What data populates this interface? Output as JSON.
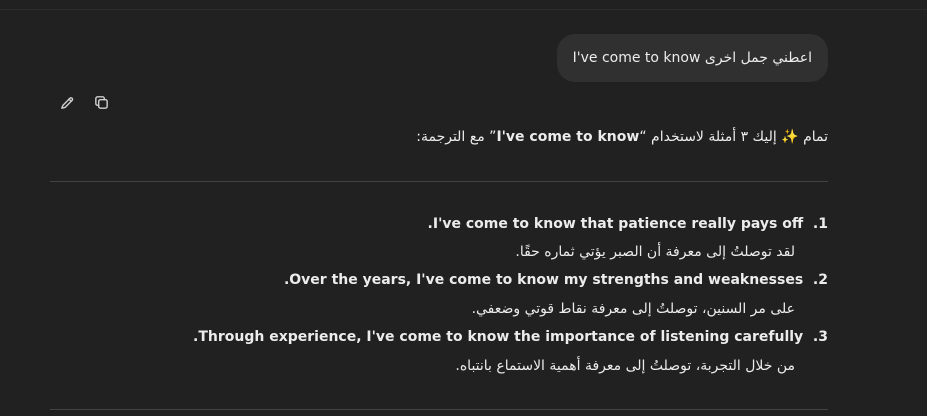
{
  "user_message": "اعطني جمل اخرى I've come to know",
  "actions": {
    "edit_icon": "pencil-icon",
    "copy_icon": "copy-icon"
  },
  "reply": {
    "intro_before": "تمام ✨ إليك ٣ أمثلة لاستخدام “",
    "intro_phrase": "I've come to know",
    "intro_after": "” مع الترجمة:",
    "items": [
      {
        "number": "1.",
        "english": "I've come to know that patience really pays off.",
        "arabic": "لقد توصلتُ إلى معرفة أن الصبر يؤتي ثماره حقًا."
      },
      {
        "number": "2.",
        "english": "Over the years, I've come to know my strengths and weaknesses.",
        "arabic": "على مر السنين، توصلتُ إلى معرفة نقاط قوتي وضعفي."
      },
      {
        "number": "3.",
        "english": "Through experience, I've come to know the importance of listening carefully.",
        "arabic": "من خلال التجربة، توصلتُ إلى معرفة أهمية الاستماع بانتباه."
      }
    ]
  }
}
